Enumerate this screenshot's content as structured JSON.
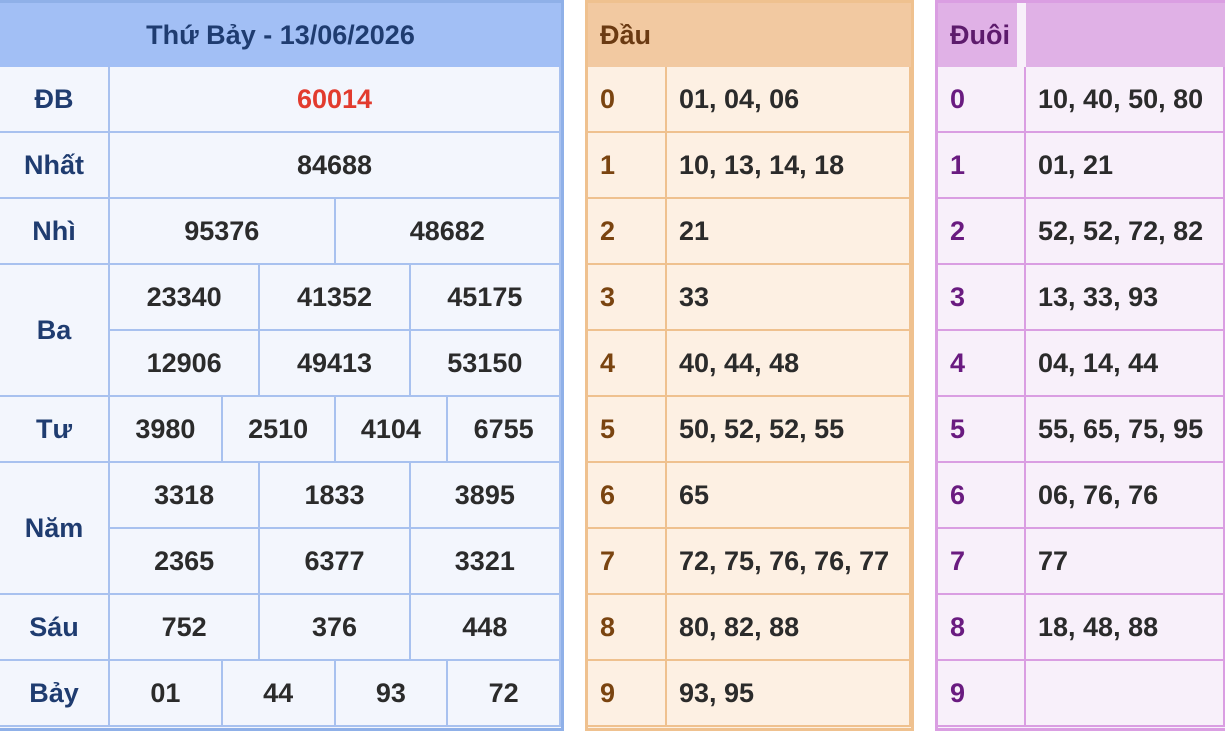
{
  "results": {
    "title": "Thứ Bảy - 13/06/2026",
    "rows": [
      {
        "label": "ĐB",
        "values": [
          "60014"
        ]
      },
      {
        "label": "Nhất",
        "values": [
          "84688"
        ]
      },
      {
        "label": "Nhì",
        "values": [
          "95376",
          "48682"
        ]
      },
      {
        "label": "Ba",
        "values": [
          "23340",
          "41352",
          "45175",
          "12906",
          "49413",
          "53150"
        ]
      },
      {
        "label": "Tư",
        "values": [
          "3980",
          "2510",
          "4104",
          "6755"
        ]
      },
      {
        "label": "Năm",
        "values": [
          "3318",
          "1833",
          "3895",
          "2365",
          "6377",
          "3321"
        ]
      },
      {
        "label": "Sáu",
        "values": [
          "752",
          "376",
          "448"
        ]
      },
      {
        "label": "Bảy",
        "values": [
          "01",
          "44",
          "93",
          "72"
        ]
      }
    ]
  },
  "dau": {
    "header": "Đầu",
    "rows": [
      {
        "key": "0",
        "values": "01, 04, 06"
      },
      {
        "key": "1",
        "values": "10, 13, 14, 18"
      },
      {
        "key": "2",
        "values": "21"
      },
      {
        "key": "3",
        "values": "33"
      },
      {
        "key": "4",
        "values": "40, 44, 48"
      },
      {
        "key": "5",
        "values": "50, 52, 52, 55"
      },
      {
        "key": "6",
        "values": "65"
      },
      {
        "key": "7",
        "values": "72, 75, 76, 76, 77"
      },
      {
        "key": "8",
        "values": "80, 82, 88"
      },
      {
        "key": "9",
        "values": "93, 95"
      }
    ]
  },
  "duoi": {
    "header": "Đuôi",
    "rows": [
      {
        "key": "0",
        "values": "10, 40, 50, 80"
      },
      {
        "key": "1",
        "values": "01, 21"
      },
      {
        "key": "2",
        "values": "52, 52, 72, 82"
      },
      {
        "key": "3",
        "values": "13, 33, 93"
      },
      {
        "key": "4",
        "values": "04, 14, 44"
      },
      {
        "key": "5",
        "values": "55, 65, 75, 95"
      },
      {
        "key": "6",
        "values": "06, 76, 76"
      },
      {
        "key": "7",
        "values": "77"
      },
      {
        "key": "8",
        "values": "18, 48, 88"
      },
      {
        "key": "9",
        "values": ""
      }
    ]
  },
  "colors": {
    "special_prize": "#e23b2e",
    "results_header": "#a2bff5",
    "dau_header": "#f2c9a1",
    "duoi_header": "#e0b1e6"
  }
}
